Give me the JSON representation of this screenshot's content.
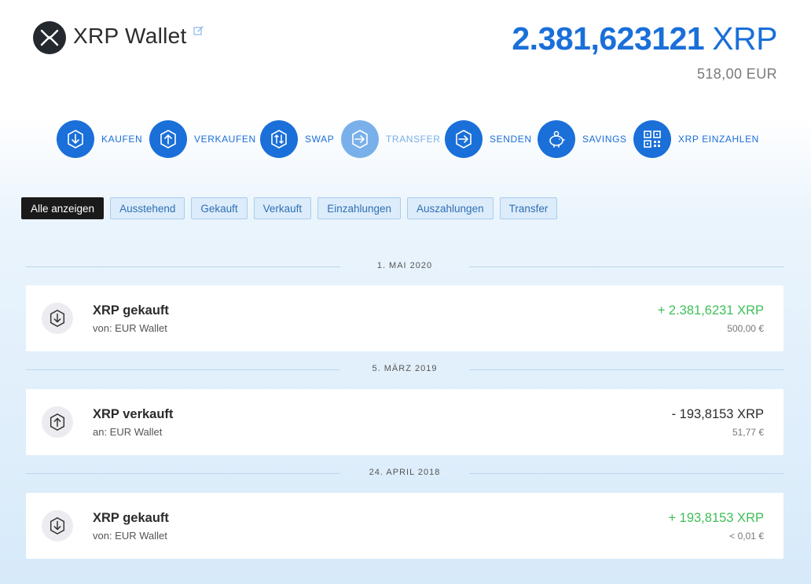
{
  "header": {
    "title": "XRP Wallet",
    "balance": "2.381,623121",
    "balance_unit": "XRP",
    "fiat_value": "518,00 EUR",
    "logo_icon": "xrp-logo-icon",
    "edit_icon": "edit-icon"
  },
  "actions": [
    {
      "label": "KAUFEN",
      "icon": "arrow-down-icon"
    },
    {
      "label": "VERKAUFEN",
      "icon": "arrow-up-icon"
    },
    {
      "label": "SWAP",
      "icon": "swap-icon"
    },
    {
      "label": "TRANSFER",
      "icon": "arrow-right-icon",
      "active": true
    },
    {
      "label": "SENDEN",
      "icon": "send-icon"
    },
    {
      "label": "SAVINGS",
      "icon": "piggy-bank-icon"
    },
    {
      "label": "XRP EINZAHLEN",
      "icon": "qr-code-icon"
    }
  ],
  "filters": [
    {
      "label": "Alle anzeigen",
      "active": true
    },
    {
      "label": "Ausstehend"
    },
    {
      "label": "Gekauft"
    },
    {
      "label": "Verkauft"
    },
    {
      "label": "Einzahlungen"
    },
    {
      "label": "Auszahlungen"
    },
    {
      "label": "Transfer"
    }
  ],
  "groups": [
    {
      "date": "1. MAI 2020",
      "transactions": [
        {
          "title": "XRP gekauft",
          "sub": "von: EUR Wallet",
          "amount": "+ 2.381,6231 XRP",
          "fiat": "500,00 €",
          "direction": "in",
          "icon": "arrow-down-icon"
        }
      ]
    },
    {
      "date": "5. MÄRZ 2019",
      "transactions": [
        {
          "title": "XRP verkauft",
          "sub": "an: EUR Wallet",
          "amount": "- 193,8153 XRP",
          "fiat": "51,77 €",
          "direction": "out",
          "icon": "arrow-up-icon"
        }
      ]
    },
    {
      "date": "24. APRIL 2018",
      "transactions": [
        {
          "title": "XRP gekauft",
          "sub": "von: EUR Wallet",
          "amount": "+ 193,8153 XRP",
          "fiat": "< 0,01 €",
          "direction": "in",
          "icon": "arrow-down-icon"
        }
      ]
    }
  ],
  "colors": {
    "accent": "#1a6fd9",
    "accent_muted": "#7ab0ea",
    "positive": "#3fbf57",
    "logo_bg": "#23292f"
  }
}
